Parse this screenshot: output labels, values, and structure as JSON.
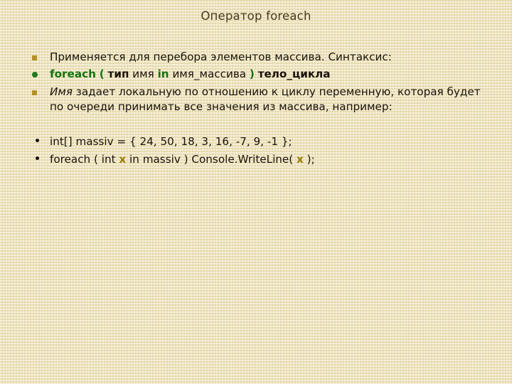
{
  "slide": {
    "title": "Оператор foreach",
    "background_color": "#f0e6bc",
    "title_color": "#4a3b20",
    "body_text_color": "#1a1208",
    "keyword_color": "#13730f",
    "variable_color": "#9a7d0a",
    "square_bullet_color": "#b39125",
    "green_bullet_color": "#1f7a1f"
  },
  "bullets": {
    "intro": {
      "marker": "square-bullet",
      "text": "Применяется для перебора элементов массива. Синтаксис:"
    },
    "syntax": {
      "marker": "green-circle-bullet",
      "kw_foreach": "foreach",
      "paren_open": "(",
      "word_type": "тип",
      "word_name": "имя",
      "kw_in": "in",
      "word_array_name": "имя_массива",
      "paren_close": ")",
      "word_loop_body": "тело_цикла"
    },
    "description": {
      "marker": "square-bullet",
      "emphasis": "Имя",
      "text": " задает локальную по отношению к циклу переменную, которая будет по очереди принимать все значения из массива, например:"
    }
  },
  "code": {
    "line1": {
      "marker": "dot-bullet",
      "before": "int[] massiv =  { 24, 50, 18, 3, 16, -7, 9, -1 };"
    },
    "line2": {
      "marker": "dot-bullet",
      "part1": "foreach ( int ",
      "var1": "x",
      "part2": " in massiv ) Console.WriteLine( ",
      "var2": "x",
      "part3": " );"
    }
  }
}
